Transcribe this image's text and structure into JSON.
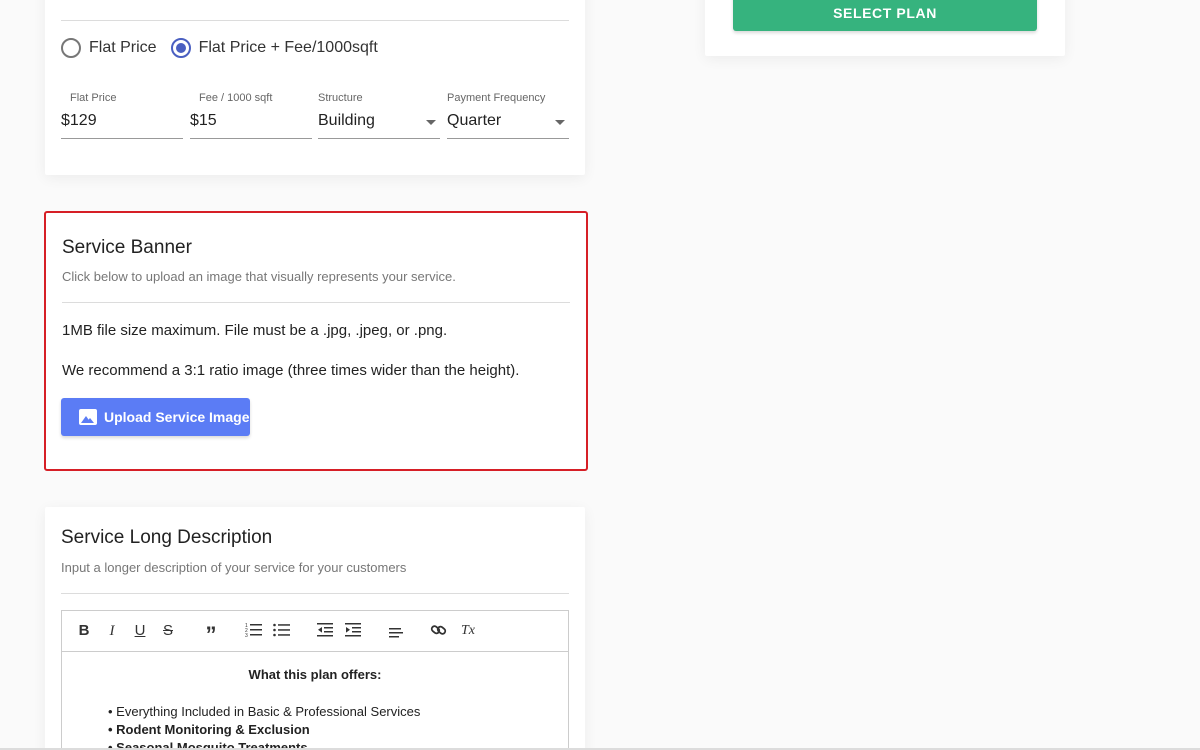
{
  "pricing": {
    "options": [
      {
        "label": "Flat Price",
        "checked": false
      },
      {
        "label": "Flat Price + Fee/1000sqft",
        "checked": true
      }
    ],
    "fields": [
      {
        "label": "Flat Price",
        "value": "$129"
      },
      {
        "label": "Fee / 1000 sqft",
        "value": "$15"
      },
      {
        "label": "Structure",
        "value": "Building"
      },
      {
        "label": "Payment Frequency",
        "value": "Quarter"
      }
    ]
  },
  "plan": {
    "select_label": "SELECT PLAN"
  },
  "banner": {
    "title": "Service Banner",
    "subtitle": "Click below to upload an image that visually represents your service.",
    "line1": "1MB file size maximum. File must be a .jpg, .jpeg, or .png.",
    "line2": "We recommend a 3:1 ratio image (three times wider than the height).",
    "upload_label": "Upload Service Image"
  },
  "description": {
    "title": "Service Long Description",
    "subtitle": "Input a longer description of your service for your customers",
    "toolbar": {
      "bold": "B",
      "italic": "I",
      "underline": "U",
      "strike": "S",
      "quote": "”",
      "clear": "Tx"
    },
    "content_heading": "What this plan offers:",
    "content_items": [
      "Everything Included in Basic & Professional Services",
      "Rodent Monitoring & Exclusion",
      "Seasonal Mosquito Treatments"
    ]
  },
  "colors": {
    "accent_green": "#36b37e",
    "accent_blue": "#5b7cf5",
    "radio_blue": "#4a5fc1",
    "highlight_red": "#d61f26"
  }
}
